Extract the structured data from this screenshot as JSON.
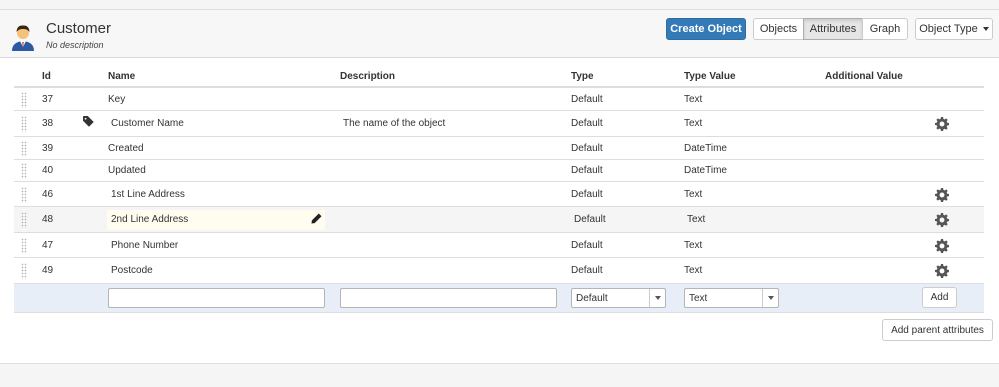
{
  "header": {
    "title": "Customer",
    "subtitle": "No description"
  },
  "toolbar": {
    "create_label": "Create Object",
    "view_tabs": [
      {
        "label": "Objects",
        "active": false
      },
      {
        "label": "Attributes",
        "active": true
      },
      {
        "label": "Graph",
        "active": false
      }
    ],
    "object_type_label": "Object Type"
  },
  "table": {
    "columns": [
      "Id",
      "Name",
      "Description",
      "Type",
      "Type Value",
      "Additional Value"
    ],
    "rows": [
      {
        "id": "37",
        "name": "Key",
        "description": "",
        "type": "Default",
        "type_value": "Text",
        "tag": false,
        "gear": false
      },
      {
        "id": "38",
        "name": "Customer Name",
        "description": "The name of the object",
        "type": "Default",
        "type_value": "Text",
        "tag": true,
        "gear": true
      },
      {
        "id": "39",
        "name": "Created",
        "description": "",
        "type": "Default",
        "type_value": "DateTime",
        "tag": false,
        "gear": false
      },
      {
        "id": "40",
        "name": "Updated",
        "description": "",
        "type": "Default",
        "type_value": "DateTime",
        "tag": false,
        "gear": false
      },
      {
        "id": "46",
        "name": "1st Line Address",
        "description": "",
        "type": "Default",
        "type_value": "Text",
        "tag": false,
        "gear": true
      },
      {
        "id": "48",
        "name": "2nd Line Address",
        "description": "",
        "type": "Default",
        "type_value": "Text",
        "tag": false,
        "gear": true,
        "editing": true
      },
      {
        "id": "47",
        "name": "Phone Number",
        "description": "",
        "type": "Default",
        "type_value": "Text",
        "tag": false,
        "gear": true
      },
      {
        "id": "49",
        "name": "Postcode",
        "description": "",
        "type": "Default",
        "type_value": "Text",
        "tag": false,
        "gear": true
      }
    ]
  },
  "add_row": {
    "name_value": "",
    "description_value": "",
    "type_selected": "Default",
    "type_value_selected": "Text",
    "add_label": "Add"
  },
  "parent_button_label": "Add parent attributes",
  "icons": {
    "avatar": "user-avatar-icon",
    "drag": "drag-handle-icon",
    "tag": "tag-icon",
    "gear": "gear-icon",
    "pencil": "pencil-icon",
    "caret": "caret-down-icon"
  },
  "colors": {
    "primary": "#337ab7",
    "add_row_bg": "#e8eef8"
  }
}
